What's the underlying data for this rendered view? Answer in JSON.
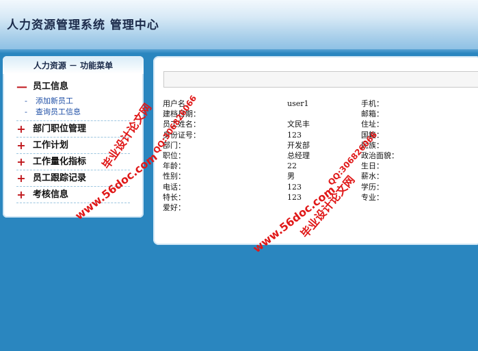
{
  "header": {
    "title": "人力资源管理系统  管理中心"
  },
  "sidebar": {
    "title": "人力资源 － 功能菜单",
    "groups": [
      {
        "symbol": "—",
        "label": "员工信息",
        "items": [
          {
            "label": "添加新员工"
          },
          {
            "label": "查询员工信息"
          }
        ]
      },
      {
        "symbol": "+",
        "label": "部门职位管理"
      },
      {
        "symbol": "+",
        "label": "工作计划"
      },
      {
        "symbol": "+",
        "label": "工作量化指标"
      },
      {
        "symbol": "+",
        "label": "员工跟踪记录"
      },
      {
        "symbol": "+",
        "label": "考核信息"
      }
    ]
  },
  "search": {
    "value": ""
  },
  "detail": {
    "left": [
      {
        "label": "用户名：",
        "value": "user1"
      },
      {
        "label": "建档日期：",
        "value": ""
      },
      {
        "label": "员工姓名：",
        "value": "文民丰"
      },
      {
        "label": "身份证号：",
        "value": "123"
      },
      {
        "label": "部门：",
        "value": "开发部"
      },
      {
        "label": "职位：",
        "value": "总经理"
      },
      {
        "label": "年龄：",
        "value": "22"
      },
      {
        "label": "性别：",
        "value": "男"
      },
      {
        "label": "电话：",
        "value": "123"
      },
      {
        "label": "特长：",
        "value": "123"
      },
      {
        "label": "爱好：",
        "value": ""
      }
    ],
    "right": [
      {
        "label": "手机："
      },
      {
        "label": "邮箱："
      },
      {
        "label": "住址："
      },
      {
        "label": "国籍："
      },
      {
        "label": "民族："
      },
      {
        "label": "政治面貌："
      },
      {
        "label": "生日："
      },
      {
        "label": "薪水："
      },
      {
        "label": "学历："
      },
      {
        "label": "专业："
      }
    ]
  },
  "watermarks": {
    "site": "www.56doc.com",
    "qq": "QQ:306826066",
    "name": "毕业设计论文网"
  },
  "colors": {
    "background": "#2a86bf",
    "accent_red": "#c0161b",
    "link_blue": "#1f4fa6"
  }
}
